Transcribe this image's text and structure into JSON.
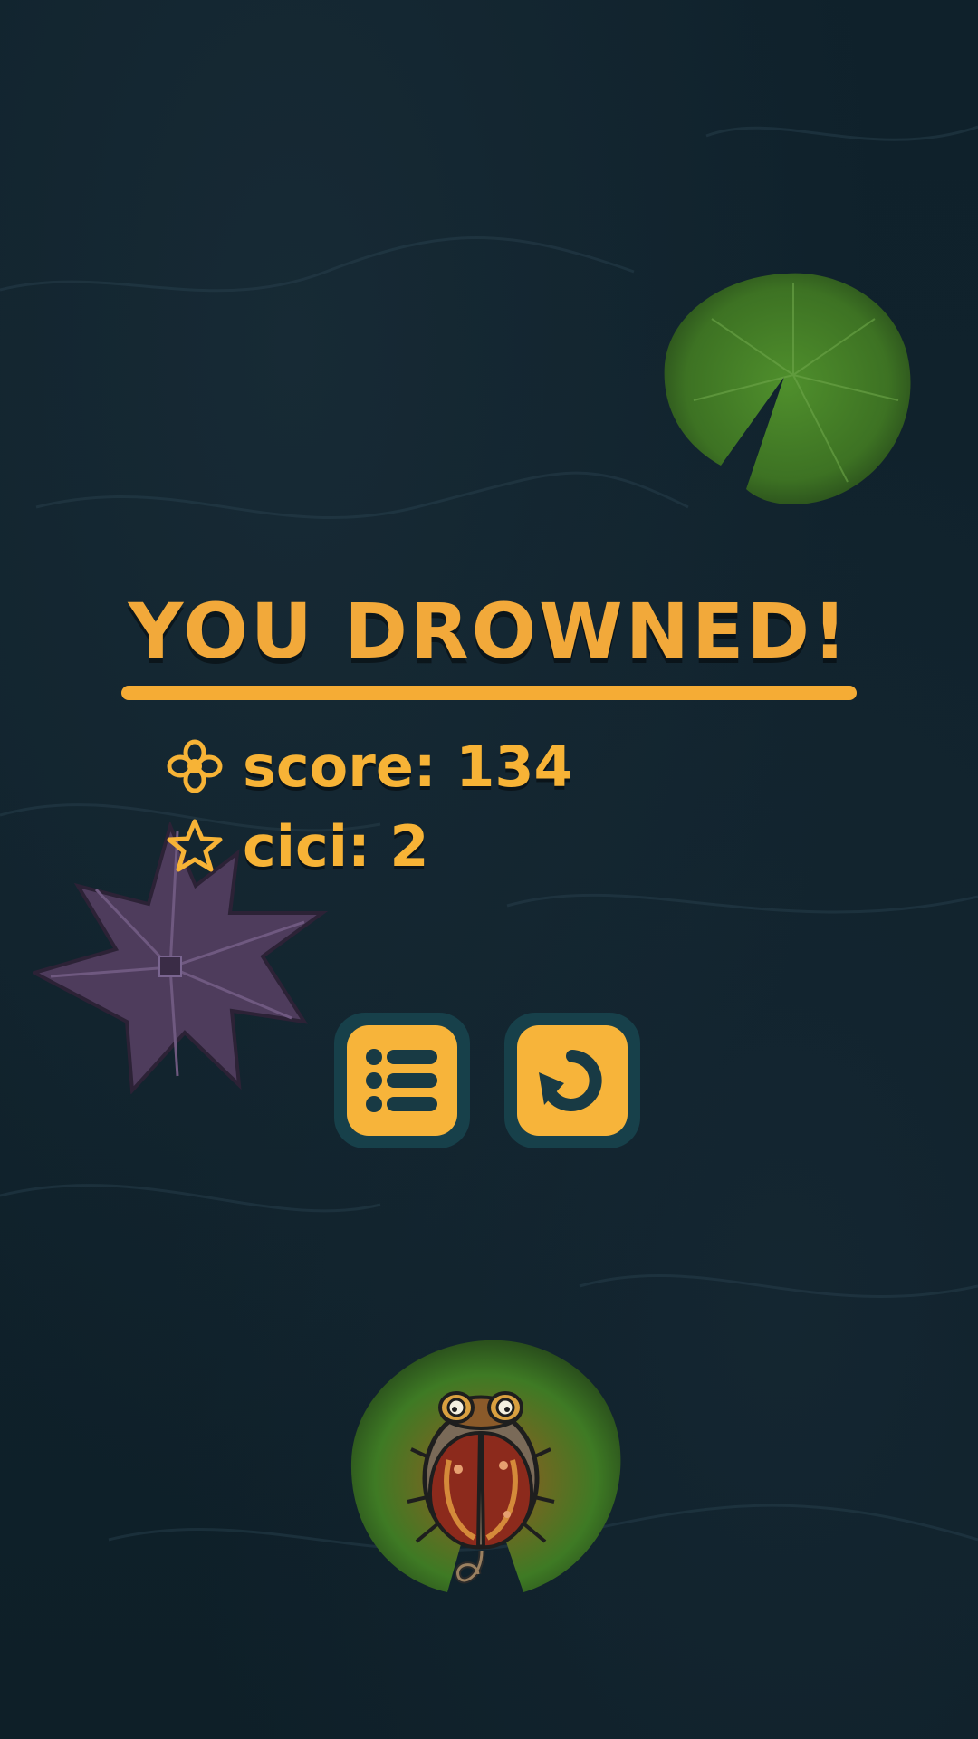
{
  "game": {
    "title": "YOU DROWNED!",
    "stats": [
      {
        "icon": "flower-icon",
        "label": "score: 134"
      },
      {
        "icon": "star-icon",
        "label": "cici: 2"
      }
    ],
    "buttons": [
      {
        "name": "menu-button",
        "icon": "list-icon"
      },
      {
        "name": "restart-button",
        "icon": "restart-icon"
      }
    ]
  },
  "colors": {
    "background": "#0f1f29",
    "accent": "#f5ac35",
    "button_frame": "#17404a",
    "lily_pad": "#3f7a25",
    "purple_leaf": "#4e3c5c"
  }
}
